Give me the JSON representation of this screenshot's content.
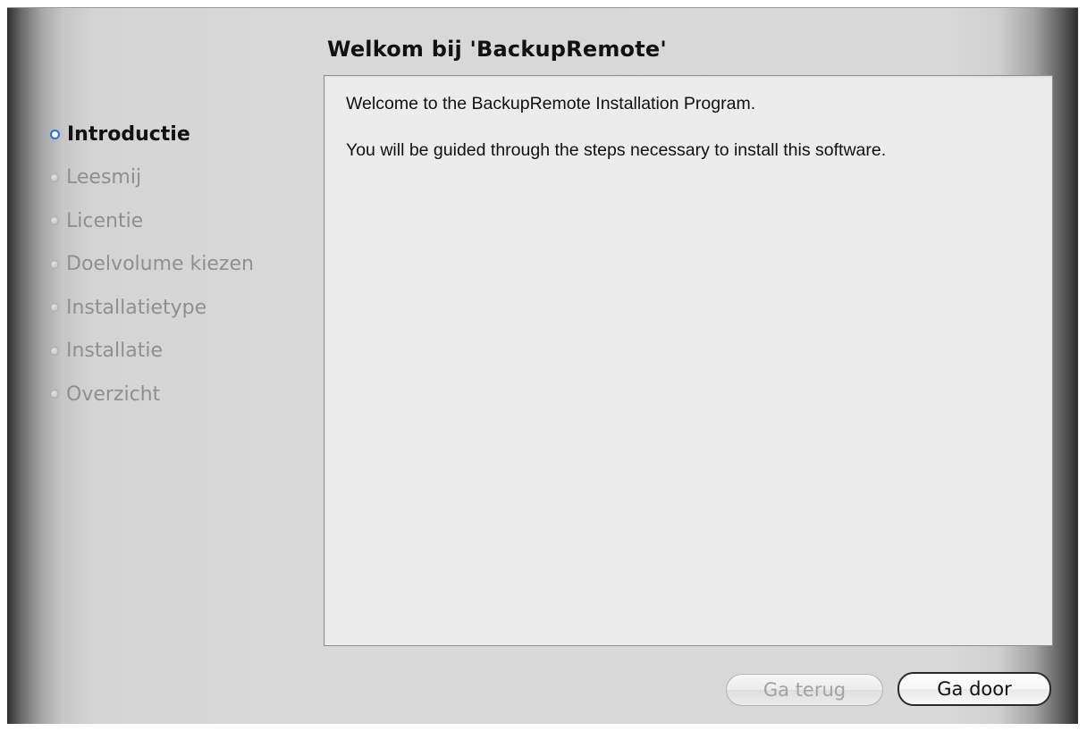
{
  "window": {
    "title": "Welkom bij 'BackupRemote'"
  },
  "sidebar": {
    "steps": [
      {
        "label": "Introductie",
        "state": "active"
      },
      {
        "label": "Leesmij",
        "state": "inactive"
      },
      {
        "label": "Licentie",
        "state": "inactive"
      },
      {
        "label": "Doelvolume kiezen",
        "state": "inactive"
      },
      {
        "label": "Installatietype",
        "state": "inactive"
      },
      {
        "label": "Installatie",
        "state": "inactive"
      },
      {
        "label": "Overzicht",
        "state": "inactive"
      }
    ]
  },
  "content": {
    "line1": "Welcome to the BackupRemote Installation Program.",
    "line2": "You will be guided through the steps necessary to install this software."
  },
  "buttons": {
    "back_label": "Ga terug",
    "back_enabled": false,
    "next_label": "Ga door",
    "next_enabled": true
  },
  "colors": {
    "active_step_indicator": "#2f6fd3",
    "inactive_step_text": "#8f8f8f"
  }
}
